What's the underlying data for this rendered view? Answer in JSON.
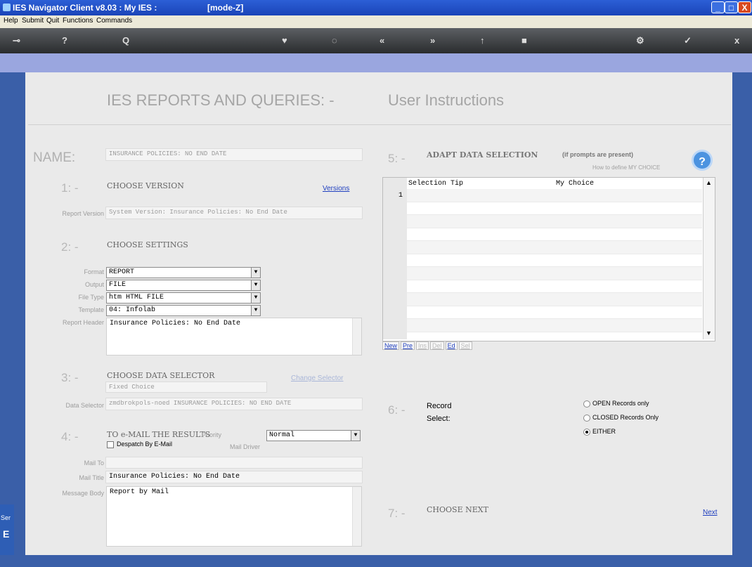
{
  "window": {
    "title": "IES Navigator Client v8.03 : My IES :",
    "mode": "[mode-Z]",
    "min_label": "_",
    "max_label": "□",
    "close_label": "X"
  },
  "menu": [
    "Help",
    "Submit",
    "Quit",
    "Functions",
    "Commands"
  ],
  "toolbar": {
    "icons": [
      {
        "name": "key-icon",
        "glyph": "⊸"
      },
      {
        "name": "help-icon",
        "glyph": "?"
      },
      {
        "name": "search-icon",
        "glyph": "Q"
      },
      {
        "name": "heart-icon",
        "glyph": "♥"
      },
      {
        "name": "refresh-icon",
        "glyph": "◌"
      },
      {
        "name": "previous-icon",
        "glyph": "«"
      },
      {
        "name": "next-icon",
        "glyph": "»"
      },
      {
        "name": "arrow-up-icon",
        "glyph": "↑"
      },
      {
        "name": "square-icon",
        "glyph": "■"
      },
      {
        "name": "gear-icon",
        "glyph": "⚙"
      },
      {
        "name": "check-icon",
        "glyph": "✓"
      },
      {
        "name": "close-icon",
        "glyph": "x"
      }
    ]
  },
  "page": {
    "title": "IES REPORTS AND QUERIES: -",
    "subtitle": "User Instructions"
  },
  "name": {
    "label": "NAME:",
    "value": "INSURANCE POLICIES: NO END DATE"
  },
  "step1": {
    "num": "1: -",
    "title": "CHOOSE VERSION",
    "link": "Versions",
    "version_label": "Report Version",
    "version_value": "System Version: Insurance Policies: No End Date"
  },
  "step2": {
    "num": "2: -",
    "title": "CHOOSE SETTINGS",
    "format_label": "Format",
    "format_value": "REPORT",
    "output_label": "Output",
    "output_value": "FILE",
    "filetype_label": "File Type",
    "filetype_value": "htm HTML FILE",
    "template_label": "Template",
    "template_value": "04: Infolab",
    "header_label": "Report Header",
    "header_value": "Insurance Policies: No End Date"
  },
  "step3": {
    "num": "3: -",
    "title": "CHOOSE DATA SELECTOR",
    "link": "Change Selector",
    "fixed_value": "Fixed Choice",
    "selector_label": "Data Selector",
    "selector_value": "zmdbrokpols-noed INSURANCE POLICIES: NO END DATE"
  },
  "step4": {
    "num": "4: -",
    "title": "TO e-MAIL THE RESULTS",
    "priority_label": "Priority",
    "priority_value": "Normal",
    "despatch_label": "Despatch By E-Mail",
    "maildriver_label": "Mail Driver",
    "mailto_label": "Mail To",
    "mailto_value": "",
    "mailtitle_label": "Mail Title",
    "mailtitle_value": "Insurance Policies: No End Date",
    "body_label": "Message Body",
    "body_value": "Report by Mail"
  },
  "step5": {
    "num": "5: -",
    "title": "ADAPT DATA SELECTION",
    "note": "(if prompts are present)",
    "help_link": "How to define MY CHOICE",
    "help_glyph": "?",
    "col1": "Selection Tip",
    "col2": "My Choice",
    "row_num": "1",
    "buttons": [
      "New",
      "Pre",
      "Ins",
      "Del",
      "Ed",
      "Sel"
    ]
  },
  "step6": {
    "num": "6: -",
    "title1": "Record",
    "title2": "Select:",
    "options": [
      {
        "label": "OPEN Records only",
        "selected": false
      },
      {
        "label": "CLOSED Records Only",
        "selected": false
      },
      {
        "label": "EITHER",
        "selected": true
      }
    ]
  },
  "step7": {
    "num": "7: -",
    "title": "CHOOSE NEXT",
    "link": "Next"
  },
  "side": {
    "tab": "Ser",
    "tab2": "E"
  }
}
